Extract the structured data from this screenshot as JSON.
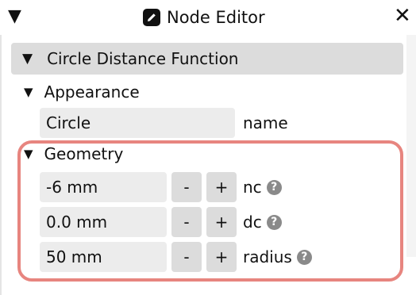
{
  "window": {
    "title": "Node Editor",
    "collapse_glyph": "▼",
    "close_glyph": "✕"
  },
  "section": {
    "title": "Circle Distance Function",
    "glyph": "▼"
  },
  "appearance": {
    "title": "Appearance",
    "glyph": "▼",
    "name_value": "Circle",
    "name_label": "name"
  },
  "geometry": {
    "title": "Geometry",
    "glyph": "▼",
    "rows": [
      {
        "value": "-6 mm",
        "label": "nc",
        "minus": "-",
        "plus": "+"
      },
      {
        "value": "0.0 mm",
        "label": "dc",
        "minus": "-",
        "plus": "+"
      },
      {
        "value": "50 mm",
        "label": "radius",
        "minus": "-",
        "plus": "+"
      }
    ]
  },
  "help_glyph": "?",
  "colors": {
    "highlight": "#e7857f",
    "field_bg": "#ececec",
    "button_bg": "#dcdcdc",
    "header_bg": "#dcdcdc"
  }
}
